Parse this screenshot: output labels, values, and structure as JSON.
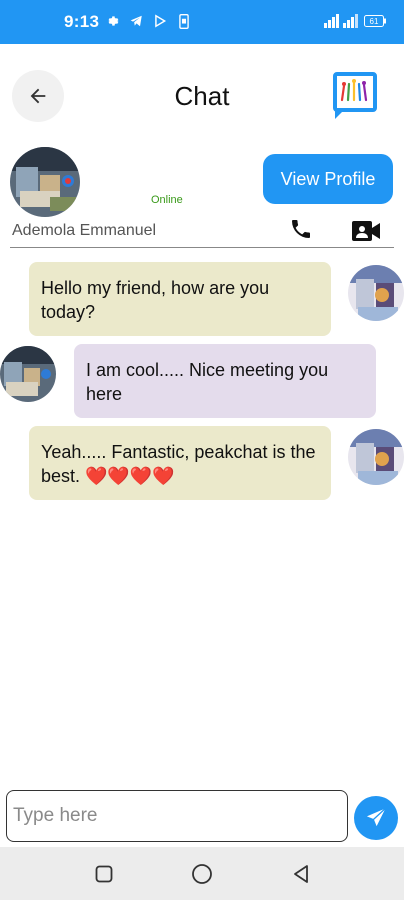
{
  "status_bar": {
    "time": "9:13",
    "background": "#2196f3",
    "icons_left": [
      "gear-icon",
      "telegram-icon",
      "play-store-icon",
      "phone-sim-icon"
    ],
    "icons_right": [
      "signal-icon",
      "battery-icon"
    ],
    "battery": "61"
  },
  "header": {
    "title": "Chat",
    "back_icon": "arrow-left-icon",
    "logo_icon": "app-logo-icon"
  },
  "contact": {
    "name": "Ademola Emmanuel",
    "status": "Online",
    "view_profile_label": "View Profile",
    "call_icon": "phone-icon",
    "video_icon": "video-call-icon"
  },
  "messages": [
    {
      "sender": "me",
      "text": "Hello my friend, how are you today?"
    },
    {
      "sender": "them",
      "text": "I am cool..... Nice meeting you here"
    },
    {
      "sender": "me",
      "text": "Yeah..... Fantastic, peakchat is the best. ❤️❤️❤️❤️"
    }
  ],
  "composer": {
    "placeholder": "Type here",
    "value": "",
    "send_icon": "send-icon"
  },
  "nav": {
    "recent_icon": "square-icon",
    "home_icon": "circle-icon",
    "back_icon": "triangle-back-icon"
  },
  "colors": {
    "accent": "#2196f3",
    "my_bubble": "#ebe9cb",
    "their_bubble": "#e4dcec",
    "online": "#3a9a1a"
  }
}
